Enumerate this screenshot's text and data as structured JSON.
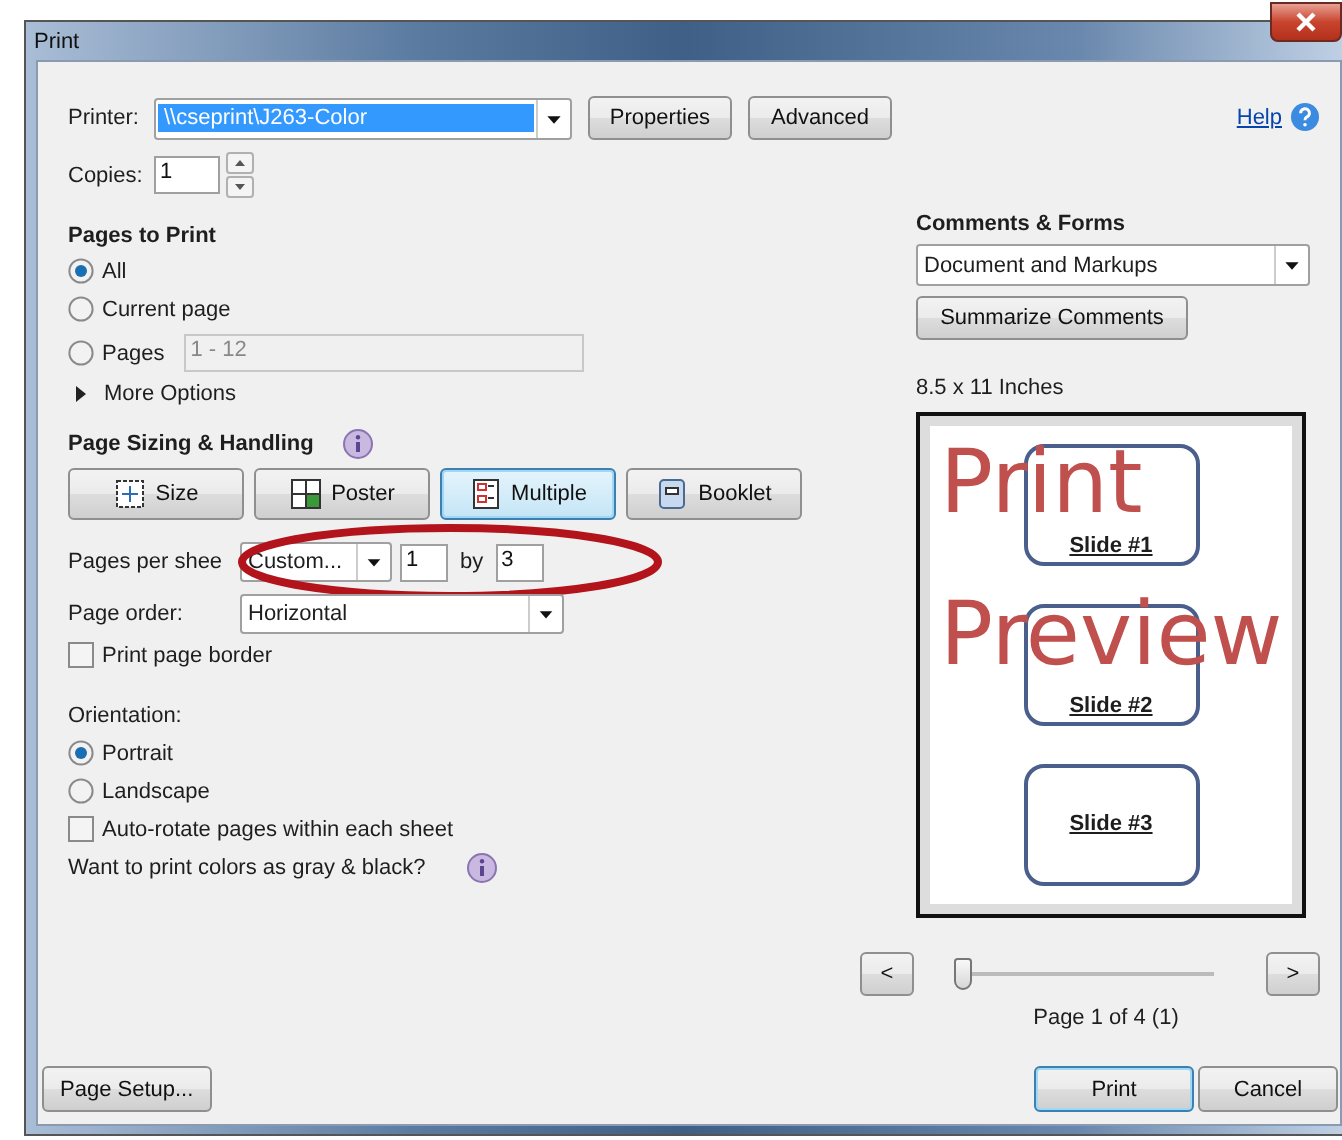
{
  "window": {
    "title": "Print"
  },
  "help": {
    "label": "Help"
  },
  "printer": {
    "label": "Printer:",
    "value": "\\\\cseprint\\J263-Color"
  },
  "printer_buttons": [
    "Properties",
    "Advanced"
  ],
  "copies": {
    "label": "Copies:",
    "value": "1"
  },
  "pages_to_print": {
    "title": "Pages to Print",
    "options": [
      {
        "label": "All",
        "selected": true
      },
      {
        "label": "Current page",
        "selected": false
      },
      {
        "label": "Pages",
        "selected": false,
        "range": "1 - 12"
      }
    ],
    "more_options": {
      "label": "More Options",
      "expanded": false
    }
  },
  "page_sizing": {
    "title": "Page Sizing & Handling",
    "modes": [
      {
        "label": "Size",
        "selected": false,
        "kind": "size"
      },
      {
        "label": "Poster",
        "selected": false,
        "kind": "poster"
      },
      {
        "label": "Multiple",
        "selected": true,
        "kind": "multiple"
      },
      {
        "label": "Booklet",
        "selected": false,
        "kind": "booklet"
      }
    ],
    "pages_per_sheet": {
      "label": "Pages per shee",
      "value": "Custom...",
      "columns": "1",
      "by": "by",
      "rows": "3"
    },
    "page_order": {
      "label": "Page order:",
      "value": "Horizontal"
    },
    "print_page_border": {
      "label": "Print page border",
      "checked": false
    }
  },
  "orientation": {
    "title": "Orientation:",
    "options": [
      {
        "label": "Portrait",
        "selected": true
      },
      {
        "label": "Landscape",
        "selected": false
      }
    ]
  },
  "auto_rotate": {
    "label": "Auto-rotate pages within each sheet",
    "checked": false
  },
  "gray_question": "Want to print colors as gray & black?",
  "comments_forms": {
    "title": "Comments & Forms",
    "value": "Document and Markups",
    "button": "Summarize Comments"
  },
  "preview": {
    "paper_size": "8.5 x 11 Inches",
    "slides": [
      "Slide #1",
      "Slide #2",
      "Slide #3"
    ],
    "overlay": [
      "Print",
      "Preview"
    ]
  },
  "navigation": {
    "previous": "<",
    "next": ">",
    "level": 0,
    "page_info": "Page 1 of 4 (1)"
  },
  "buttons": {
    "page_setup": "Page Setup...",
    "print": "Print",
    "cancel": "Cancel"
  }
}
